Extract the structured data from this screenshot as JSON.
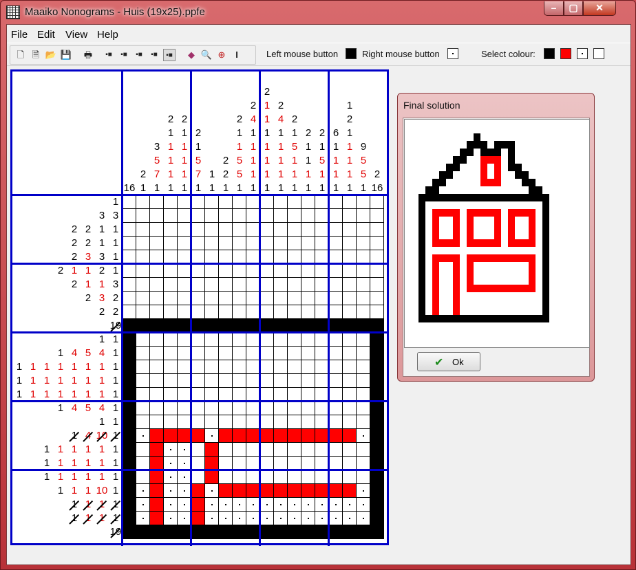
{
  "window": {
    "title": "Maaiko Nonograms - Huis (19x25).ppfe"
  },
  "menu": [
    "File",
    "Edit",
    "View",
    "Help"
  ],
  "toolbar": {
    "left_label": "Left mouse button",
    "right_label": "Right mouse button",
    "select_colour_label": "Select colour:",
    "icons": [
      "new-icon",
      "open-icon",
      "open-folder-icon",
      "save-icon",
      "print-icon",
      "view-mode-1-icon",
      "view-mode-2-icon",
      "view-mode-3-icon",
      "view-mode-4-icon",
      "view-mode-5-icon",
      "solver-book-icon",
      "preview-icon",
      "zoom-icon",
      "cursor-icon"
    ],
    "colors": {
      "black": "#000000",
      "red": "#ff0000",
      "white": "#ffffff"
    }
  },
  "colors": {
    "grid_border": "#0000c8",
    "clue_red": "#e00000"
  },
  "column_clues": [
    [
      [
        "16",
        "k"
      ]
    ],
    [
      [
        "2",
        "k"
      ],
      [
        "1",
        "k"
      ]
    ],
    [
      [
        "3",
        "k"
      ],
      [
        "5",
        "r"
      ],
      [
        "7",
        "r"
      ],
      [
        "1",
        "k"
      ]
    ],
    [
      [
        "2",
        "k"
      ],
      [
        "1",
        "k"
      ],
      [
        "1",
        "r"
      ],
      [
        "1",
        "r"
      ],
      [
        "1",
        "r"
      ],
      [
        "1",
        "k"
      ]
    ],
    [
      [
        "2",
        "k"
      ],
      [
        "1",
        "k"
      ],
      [
        "1",
        "r"
      ],
      [
        "1",
        "r"
      ],
      [
        "1",
        "r"
      ],
      [
        "1",
        "k"
      ]
    ],
    [
      [
        "2",
        "k"
      ],
      [
        "1",
        "k"
      ],
      [
        "5",
        "r"
      ],
      [
        "7",
        "r"
      ],
      [
        "1",
        "k"
      ]
    ],
    [
      [
        "1",
        "k"
      ],
      [
        "1",
        "k"
      ]
    ],
    [
      [
        "2",
        "k"
      ],
      [
        "2",
        "k"
      ],
      [
        "1",
        "k"
      ]
    ],
    [
      [
        "2",
        "k"
      ],
      [
        "1",
        "k"
      ],
      [
        "1",
        "r"
      ],
      [
        "5",
        "r"
      ],
      [
        "5",
        "r"
      ],
      [
        "1",
        "k"
      ]
    ],
    [
      [
        "2",
        "k"
      ],
      [
        "4",
        "r"
      ],
      [
        "1",
        "k"
      ],
      [
        "1",
        "r"
      ],
      [
        "1",
        "r"
      ],
      [
        "1",
        "r"
      ],
      [
        "1",
        "k"
      ]
    ],
    [
      [
        "2",
        "k"
      ],
      [
        "1",
        "r"
      ],
      [
        "1",
        "r"
      ],
      [
        "1",
        "k"
      ],
      [
        "1",
        "r"
      ],
      [
        "1",
        "r"
      ],
      [
        "1",
        "r"
      ],
      [
        "1",
        "k"
      ]
    ],
    [
      [
        "2",
        "k"
      ],
      [
        "4",
        "r"
      ],
      [
        "1",
        "k"
      ],
      [
        "1",
        "r"
      ],
      [
        "1",
        "r"
      ],
      [
        "1",
        "r"
      ],
      [
        "1",
        "k"
      ]
    ],
    [
      [
        "2",
        "k"
      ],
      [
        "1",
        "k"
      ],
      [
        "5",
        "r"
      ],
      [
        "1",
        "r"
      ],
      [
        "1",
        "r"
      ],
      [
        "1",
        "k"
      ]
    ],
    [
      [
        "2",
        "k"
      ],
      [
        "1",
        "k"
      ],
      [
        "1",
        "k"
      ],
      [
        "1",
        "r"
      ],
      [
        "1",
        "k"
      ]
    ],
    [
      [
        "2",
        "k"
      ],
      [
        "1",
        "k"
      ],
      [
        "5",
        "r"
      ],
      [
        "1",
        "r"
      ],
      [
        "1",
        "k"
      ]
    ],
    [
      [
        "6",
        "k"
      ],
      [
        "1",
        "k"
      ],
      [
        "1",
        "r"
      ],
      [
        "1",
        "r"
      ],
      [
        "1",
        "k"
      ]
    ],
    [
      [
        "1",
        "k"
      ],
      [
        "2",
        "k"
      ],
      [
        "1",
        "k"
      ],
      [
        "1",
        "r"
      ],
      [
        "1",
        "r"
      ],
      [
        "1",
        "r"
      ],
      [
        "1",
        "k"
      ]
    ],
    [
      [
        "9",
        "k"
      ],
      [
        "5",
        "r"
      ],
      [
        "5",
        "r"
      ],
      [
        "1",
        "k"
      ]
    ],
    [
      [
        "2",
        "k"
      ],
      [
        "16",
        "k"
      ]
    ]
  ],
  "row_clues": [
    [
      [
        "1",
        "k"
      ]
    ],
    [
      [
        "3",
        "k"
      ],
      [
        "3",
        "k"
      ]
    ],
    [
      [
        "2",
        "k"
      ],
      [
        "2",
        "k"
      ],
      [
        "1",
        "k"
      ],
      [
        "1",
        "k"
      ]
    ],
    [
      [
        "2",
        "k"
      ],
      [
        "2",
        "k"
      ],
      [
        "1",
        "k"
      ],
      [
        "1",
        "k"
      ]
    ],
    [
      [
        "2",
        "k"
      ],
      [
        "3",
        "r"
      ],
      [
        "3",
        "k"
      ],
      [
        "1",
        "k"
      ]
    ],
    [
      [
        "2",
        "k"
      ],
      [
        "1",
        "r"
      ],
      [
        "1",
        "r"
      ],
      [
        "2",
        "k"
      ],
      [
        "1",
        "k"
      ]
    ],
    [
      [
        "2",
        "k"
      ],
      [
        "1",
        "r"
      ],
      [
        "1",
        "r"
      ],
      [
        "3",
        "k"
      ]
    ],
    [
      [
        "2",
        "k"
      ],
      [
        "3",
        "r"
      ],
      [
        "2",
        "k"
      ]
    ],
    [
      [
        "2",
        "k"
      ],
      [
        "2",
        "k"
      ]
    ],
    [
      [
        "19",
        "k"
      ]
    ],
    [
      [
        "1",
        "k"
      ],
      [
        "1",
        "k"
      ]
    ],
    [
      [
        "1",
        "k"
      ],
      [
        "4",
        "r"
      ],
      [
        "5",
        "r"
      ],
      [
        "4",
        "r"
      ],
      [
        "1",
        "k"
      ]
    ],
    [
      [
        "1",
        "k"
      ],
      [
        "1",
        "r"
      ],
      [
        "1",
        "r"
      ],
      [
        "1",
        "r"
      ],
      [
        "1",
        "r"
      ],
      [
        "1",
        "r"
      ],
      [
        "1",
        "r"
      ],
      [
        "1",
        "k"
      ]
    ],
    [
      [
        "1",
        "k"
      ],
      [
        "1",
        "r"
      ],
      [
        "1",
        "r"
      ],
      [
        "1",
        "r"
      ],
      [
        "1",
        "r"
      ],
      [
        "1",
        "r"
      ],
      [
        "1",
        "r"
      ],
      [
        "1",
        "k"
      ]
    ],
    [
      [
        "1",
        "k"
      ],
      [
        "1",
        "r"
      ],
      [
        "1",
        "r"
      ],
      [
        "1",
        "r"
      ],
      [
        "1",
        "r"
      ],
      [
        "1",
        "r"
      ],
      [
        "1",
        "r"
      ],
      [
        "1",
        "k"
      ]
    ],
    [
      [
        "1",
        "k"
      ],
      [
        "4",
        "r"
      ],
      [
        "5",
        "r"
      ],
      [
        "4",
        "r"
      ],
      [
        "1",
        "k"
      ]
    ],
    [
      [
        "1",
        "k"
      ],
      [
        "1",
        "k"
      ]
    ],
    [
      [
        "1",
        "k"
      ],
      [
        "4",
        "r"
      ],
      [
        "10",
        "r"
      ],
      [
        "1",
        "k"
      ]
    ],
    [
      [
        "1",
        "k"
      ],
      [
        "1",
        "r"
      ],
      [
        "1",
        "r"
      ],
      [
        "1",
        "r"
      ],
      [
        "1",
        "r"
      ],
      [
        "1",
        "k"
      ]
    ],
    [
      [
        "1",
        "k"
      ],
      [
        "1",
        "r"
      ],
      [
        "1",
        "r"
      ],
      [
        "1",
        "r"
      ],
      [
        "1",
        "r"
      ],
      [
        "1",
        "k"
      ]
    ],
    [
      [
        "1",
        "k"
      ],
      [
        "1",
        "r"
      ],
      [
        "1",
        "r"
      ],
      [
        "1",
        "r"
      ],
      [
        "1",
        "r"
      ],
      [
        "1",
        "k"
      ]
    ],
    [
      [
        "1",
        "k"
      ],
      [
        "1",
        "r"
      ],
      [
        "1",
        "r"
      ],
      [
        "10",
        "r"
      ],
      [
        "1",
        "k"
      ]
    ],
    [
      [
        "1",
        "k"
      ],
      [
        "1",
        "r"
      ],
      [
        "1",
        "r"
      ],
      [
        "1",
        "k"
      ]
    ],
    [
      [
        "1",
        "k"
      ],
      [
        "1",
        "r"
      ],
      [
        "1",
        "r"
      ],
      [
        "1",
        "k"
      ]
    ],
    [
      [
        "19",
        "k"
      ]
    ]
  ],
  "struck_rows": [
    9,
    17,
    22,
    23,
    24
  ],
  "grid_rows": [
    "...................",
    "...................",
    "...................",
    "...................",
    "...................",
    "...................",
    "...................",
    "...................",
    "...................",
    "BBBBBBBBBBBBBBBBBBB",
    "B.................B",
    "B.................B",
    "B.................B",
    "B.................B",
    "B.................B",
    "B.................B",
    "B.................B",
    "BdRRRRdRRRRRRRRRRdB",
    "B.Rdd.R...........B",
    "B.Rdd.R...........B",
    "B.Rdd.R...........B",
    "BdRddRdRRRRRRRRRRdB",
    "BdRddRddddddddddddB",
    "BdRddRddddddddddddB",
    "BBBBBBBBBBBBBBBBBBB"
  ],
  "dialog": {
    "title": "Final solution",
    "ok_label": "Ok"
  },
  "solution_rows": [
    "........B..........",
    ".......BBB.BBB.....",
    "......BB.BBB.B.....",
    ".....BB..RRR.B.....",
    "....BB...R.R.BB....",
    "...BB....R.R..BB...",
    "..BB.....RRR...BB..",
    ".BB.............BB.",
    "BBBBBBBBBBBBBBBBBBB",
    "B.................B",
    "B.RRRR.RRRRR.RRRR.B",
    "B.R..R.R...R.R..R.B",
    "B.R..R.R...R.R..R.B",
    "B.R..R.R...R.R..R.B",
    "B.RRRR.RRRRR.RRRR.B",
    "B.................B",
    "B.RRRR.RRRRRRRRRR.B",
    "B.R..R.R........R.B",
    "B.R..R.R........R.B",
    "B.R..R.R........R.B",
    "B.R..R.RRRRRRRRRR.B",
    "B.R..R............B",
    "B.R..R............B",
    "B.R..R............B",
    "BBBBBBBBBBBBBBBBBBB"
  ]
}
